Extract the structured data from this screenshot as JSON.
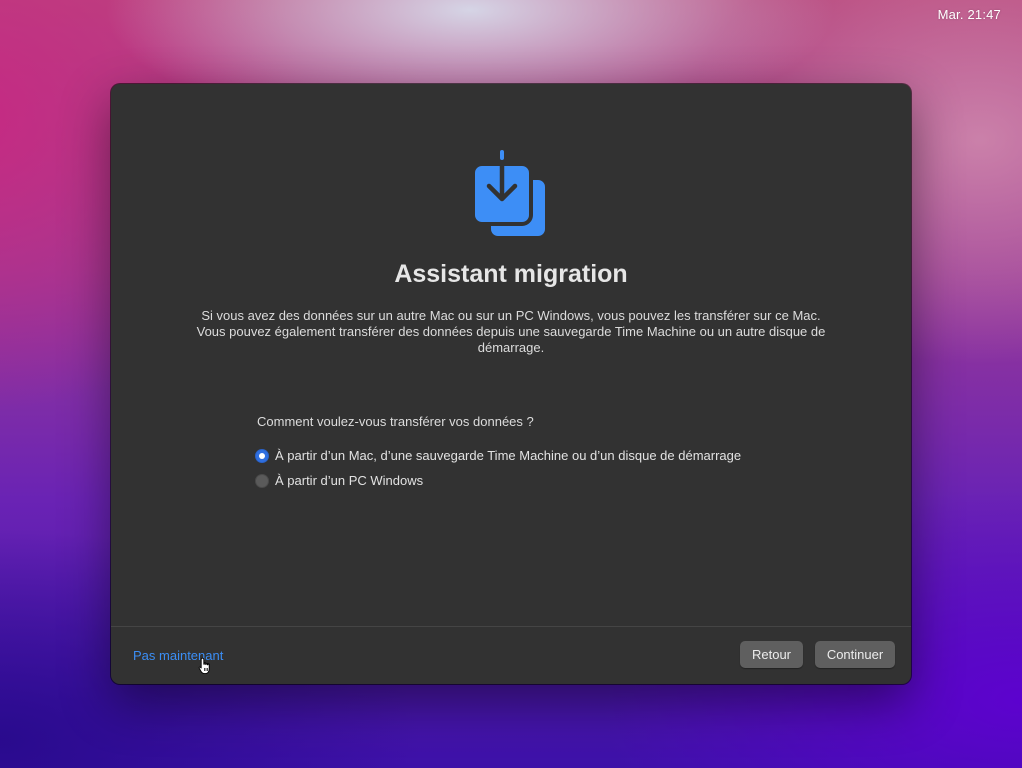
{
  "menubar": {
    "clock": "Mar. 21:47"
  },
  "window": {
    "icon": "migration-assistant-icon",
    "title": "Assistant migration",
    "description": "Si vous avez des données sur un autre Mac ou sur un PC Windows, vous pouvez les transférer sur ce Mac. Vous pouvez également transférer des données depuis une sauvegarde Time Machine ou un autre disque de démarrage.",
    "question": "Comment voulez-vous transférer vos données ?",
    "options": [
      {
        "label": "À partir d’un Mac, d’une sauvegarde Time Machine ou d’un disque de démarrage",
        "selected": true
      },
      {
        "label": "À partir d’un PC Windows",
        "selected": false
      }
    ]
  },
  "footer": {
    "not_now_label": "Pas maintenant",
    "back_label": "Retour",
    "continue_label": "Continuer"
  },
  "colors": {
    "accent": "#2f6fe0",
    "link": "#3b8ef5",
    "icon_blue": "#3d8ef6",
    "window_bg": "#323232"
  }
}
